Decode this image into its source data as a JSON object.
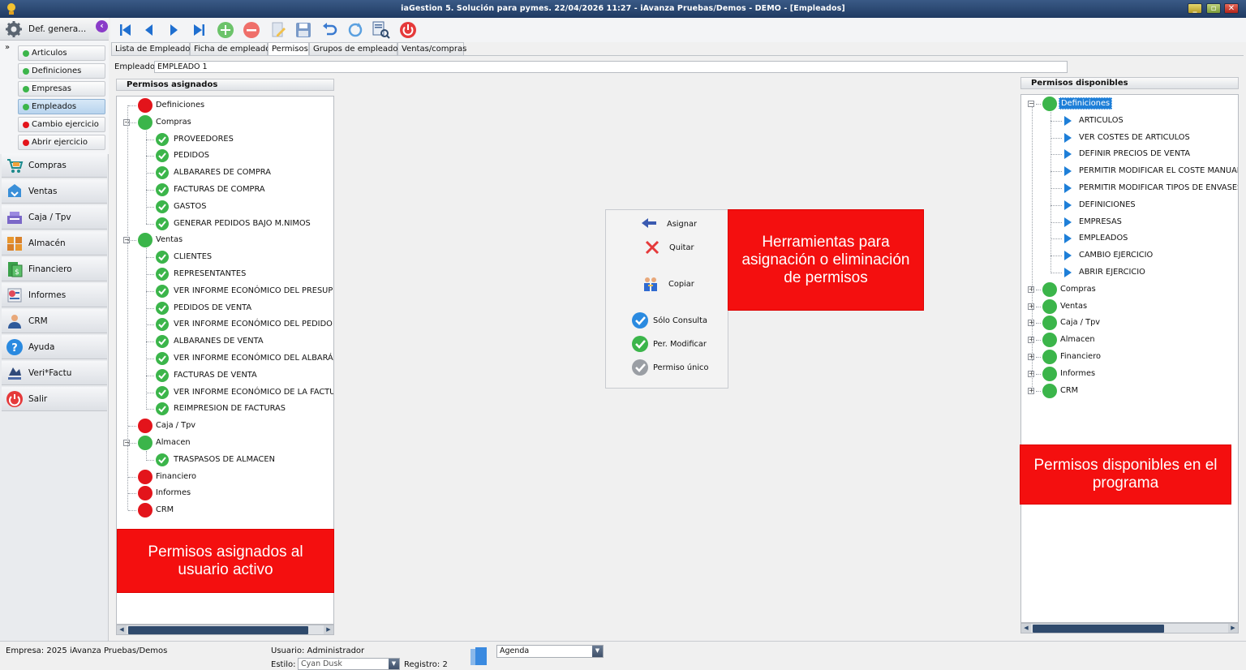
{
  "window": {
    "title": "iaGestion 5. Solución para pymes.   22/04/2026 11:27   -   iAvanza Pruebas/Demos - DEMO - [Empleados]"
  },
  "sidebar": {
    "header": "Def. genera...",
    "sub_items": [
      {
        "label": "Articulos",
        "color": "#3bb54a"
      },
      {
        "label": "Definiciones",
        "color": "#3bb54a"
      },
      {
        "label": "Empresas",
        "color": "#3bb54a"
      },
      {
        "label": "Empleados",
        "color": "#3bb54a"
      },
      {
        "label": "Cambio ejercicio",
        "color": "#e3141b"
      },
      {
        "label": "Abrir ejercicio",
        "color": "#e3141b"
      }
    ],
    "modules": [
      {
        "label": "Compras",
        "icon": "cart-icon"
      },
      {
        "label": "Ventas",
        "icon": "sales-icon"
      },
      {
        "label": "Caja / Tpv",
        "icon": "cash-register-icon"
      },
      {
        "label": "Almacén",
        "icon": "warehouse-icon"
      },
      {
        "label": "Financiero",
        "icon": "money-icon"
      },
      {
        "label": "Informes",
        "icon": "report-icon"
      },
      {
        "label": "CRM",
        "icon": "person-icon"
      },
      {
        "label": "Ayuda",
        "icon": "help-icon"
      },
      {
        "label": "Veri*Factu",
        "icon": "verifactu-icon"
      },
      {
        "label": "Salir",
        "icon": "power-icon"
      }
    ]
  },
  "tabs": [
    "Lista de Empleados",
    "Ficha de empleado",
    "Permisos",
    "Grupos de empleados",
    "Ventas/compras"
  ],
  "active_tab": "Permisos",
  "employee": {
    "label": "Empleado",
    "value": "EMPLEADO 1"
  },
  "assigned": {
    "header": "Permisos asignados",
    "groups": [
      {
        "label": "Definiciones",
        "status": "red",
        "expanded": false,
        "children": []
      },
      {
        "label": "Compras",
        "status": "green",
        "expanded": true,
        "children": [
          "PROVEEDORES",
          "PEDIDOS",
          "ALBARARES DE COMPRA",
          "FACTURAS DE COMPRA",
          "GASTOS",
          "GENERAR PEDIDOS BAJO M.NIMOS"
        ]
      },
      {
        "label": "Ventas",
        "status": "green",
        "expanded": true,
        "children": [
          "CLIENTES",
          "REPRESENTANTES",
          "VER INFORME ECONÓMICO DEL PRESUPUE",
          "PEDIDOS DE VENTA",
          "VER INFORME ECONÓMICO DEL PEDIDO",
          "ALBARANES DE VENTA",
          "VER INFORME ECONÓMICO DEL ALBARÁN",
          "FACTURAS DE VENTA",
          "VER INFORME ECONÓMICO DE LA FACTURA",
          "REIMPRESION DE FACTURAS"
        ]
      },
      {
        "label": "Caja / Tpv",
        "status": "red",
        "expanded": false,
        "children": []
      },
      {
        "label": "Almacen",
        "status": "green",
        "expanded": true,
        "children": [
          "TRASPASOS DE ALMACEN"
        ]
      },
      {
        "label": "Financiero",
        "status": "red",
        "expanded": false,
        "children": []
      },
      {
        "label": "Informes",
        "status": "red",
        "expanded": false,
        "children": []
      },
      {
        "label": "CRM",
        "status": "red",
        "expanded": false,
        "children": []
      }
    ]
  },
  "available": {
    "header": "Permisos disponibles",
    "groups": [
      {
        "label": "Definiciones",
        "selected": true,
        "expanded": true,
        "children": [
          "ARTICULOS",
          "VER COSTES DE ARTICULOS",
          "DEFINIR PRECIOS DE VENTA",
          "PERMITIR MODIFICAR EL COSTE MANUALM",
          "PERMITIR MODIFICAR TIPOS DE ENVASES",
          "DEFINICIONES",
          "EMPRESAS",
          "EMPLEADOS",
          "CAMBIO EJERCICIO",
          "ABRIR EJERCICIO"
        ]
      },
      {
        "label": "Compras",
        "selected": false,
        "expanded": false,
        "children": []
      },
      {
        "label": "Ventas",
        "selected": false,
        "expanded": false,
        "children": []
      },
      {
        "label": "Caja / Tpv",
        "selected": false,
        "expanded": false,
        "children": []
      },
      {
        "label": "Almacen",
        "selected": false,
        "expanded": false,
        "children": []
      },
      {
        "label": "Financiero",
        "selected": false,
        "expanded": false,
        "children": []
      },
      {
        "label": "Informes",
        "selected": false,
        "expanded": false,
        "children": []
      },
      {
        "label": "CRM",
        "selected": false,
        "expanded": false,
        "children": []
      }
    ]
  },
  "tools": {
    "assign": "Asignar",
    "remove": "Quitar",
    "copy": "Copiar",
    "only_consult": "Sólo Consulta",
    "per_modify": "Per.  Modificar",
    "unique_perm": "Permiso único"
  },
  "callouts": {
    "tools": "Herramientas para asignación o eliminación de permisos",
    "available": "Permisos disponibles en el programa",
    "assigned": "Permisos asignados al usuario activo"
  },
  "status": {
    "empresa": "Empresa:  2025    iAvanza Pruebas/Demos",
    "usuario": "Usuario: Administrador",
    "estilo_label": "Estilo:",
    "estilo_value": "Cyan Dusk",
    "registro": "Registro:  2",
    "agenda": "Agenda"
  },
  "colors": {
    "green": "#3bb54a",
    "red": "#e3141b",
    "callout": "#f40f0f",
    "selection": "#1e7fd8"
  }
}
